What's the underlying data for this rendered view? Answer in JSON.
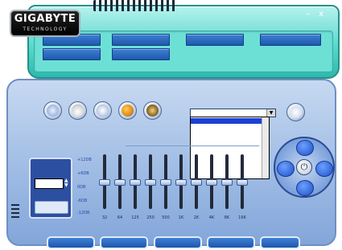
{
  "logo": {
    "main": "GIGABYTE",
    "sub": "TECHNOLOGY"
  },
  "window_controls": {
    "minimize": "–",
    "close": "x"
  },
  "top_tabs": [
    "",
    "",
    "",
    "",
    "",
    ""
  ],
  "section_label": "",
  "effect_buttons": [
    {
      "icon": "globe-icon"
    },
    {
      "icon": "bathroom-icon"
    },
    {
      "icon": "room-icon"
    },
    {
      "icon": "hall-icon"
    },
    {
      "icon": "stone-corridor-icon"
    }
  ],
  "environment_select": {
    "value": "",
    "options": [
      "",
      "",
      "",
      "",
      "",
      "",
      "",
      ""
    ],
    "highlighted_index": 0
  },
  "equalizer_title": "",
  "preset_box": {
    "label": "",
    "spinner_value": "",
    "save_button": ""
  },
  "db_scale": [
    "+12DB",
    "+6DB",
    "0DB",
    "-6DB",
    "-12DB"
  ],
  "eq_bands": [
    {
      "freq": "32",
      "gain_db": 0
    },
    {
      "freq": "64",
      "gain_db": 0
    },
    {
      "freq": "125",
      "gain_db": 0
    },
    {
      "freq": "250",
      "gain_db": 0
    },
    {
      "freq": "500",
      "gain_db": 0
    },
    {
      "freq": "1K",
      "gain_db": 0
    },
    {
      "freq": "2K",
      "gain_db": 0
    },
    {
      "freq": "4K",
      "gain_db": 0
    },
    {
      "freq": "8K",
      "gain_db": 0
    },
    {
      "freq": "16K",
      "gain_db": 0
    }
  ],
  "bottom_buttons": [
    "",
    "",
    "",
    "",
    ""
  ],
  "colors": {
    "accent": "#1f58ad",
    "panel_teal": "#55d6c9",
    "panel_blue": "#9fbce4"
  }
}
